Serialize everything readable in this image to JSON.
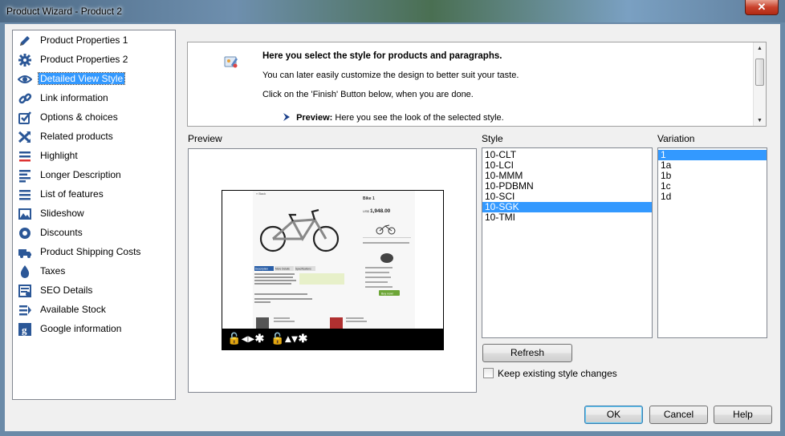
{
  "window": {
    "title": "Product Wizard - Product 2",
    "close_glyph": "✕"
  },
  "sidebar": {
    "items": [
      {
        "label": "Product Properties 1",
        "icon": "pencil-icon"
      },
      {
        "label": "Product Properties 2",
        "icon": "gear-icon"
      },
      {
        "label": "Detailed View Style",
        "icon": "eye-icon",
        "selected": true
      },
      {
        "label": "Link information",
        "icon": "link-icon"
      },
      {
        "label": "Options & choices",
        "icon": "checkbox-icon"
      },
      {
        "label": "Related products",
        "icon": "cross-arrows-icon"
      },
      {
        "label": "Highlight",
        "icon": "highlight-icon"
      },
      {
        "label": "Longer Description",
        "icon": "text-lines-icon"
      },
      {
        "label": "List of features",
        "icon": "list-icon"
      },
      {
        "label": "Slideshow",
        "icon": "image-icon"
      },
      {
        "label": "Discounts",
        "icon": "discount-badge-icon"
      },
      {
        "label": "Product Shipping Costs",
        "icon": "truck-icon"
      },
      {
        "label": "Taxes",
        "icon": "drop-icon"
      },
      {
        "label": "SEO Details",
        "icon": "seo-icon"
      },
      {
        "label": "Available Stock",
        "icon": "stock-icon"
      },
      {
        "label": "Google information",
        "icon": "google-icon"
      }
    ]
  },
  "info": {
    "heading": "Here you select the style for products and paragraphs.",
    "line1": "You can later easily customize the design to better suit your taste.",
    "line2": "Click on the 'Finish' Button below, when you are done.",
    "bullet_label": "Preview:",
    "bullet_text": " Here you see the look of the selected style."
  },
  "preview": {
    "label": "Preview"
  },
  "style": {
    "label": "Style",
    "options": [
      "10-CLT",
      "10-LCI",
      "10-MMM",
      "10-PDBMN",
      "10-SCI",
      "10-SGK",
      "10-TMI"
    ],
    "selected": "10-SGK"
  },
  "variation": {
    "label": "Variation",
    "options": [
      "1",
      "1a",
      "1b",
      "1c",
      "1d"
    ],
    "selected": "1"
  },
  "actions": {
    "refresh": "Refresh",
    "keep_changes": "Keep existing style changes",
    "ok": "OK",
    "cancel": "Cancel",
    "help": "Help"
  },
  "thumbnail": {
    "product_name": "Bike 1",
    "price": "1,948.00",
    "currency": "US$",
    "tabs": [
      "Description",
      "More Details",
      "Specifications"
    ],
    "buy_label": "Buy now!",
    "ctrl_left": "🔓◂▸✱",
    "ctrl_right": "🔓▴▾✱"
  },
  "colors": {
    "selection": "#3399ff",
    "accent": "#2a5fa8"
  }
}
